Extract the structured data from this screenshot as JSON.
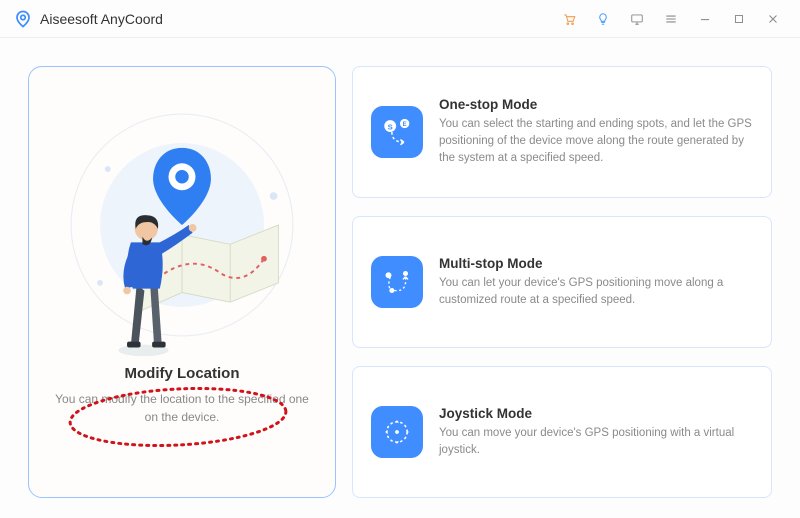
{
  "app": {
    "name": "Aiseesoft AnyCoord"
  },
  "left": {
    "title": "Modify Location",
    "desc": "You can modify the location to the specified one on the device."
  },
  "modes": [
    {
      "title": "One-stop Mode",
      "desc": "You can select the starting and ending spots, and let the GPS positioning of the device move along the route generated by the system at a specified speed."
    },
    {
      "title": "Multi-stop Mode",
      "desc": "You can let your device's GPS positioning move along a customized route at a specified speed."
    },
    {
      "title": "Joystick Mode",
      "desc": "You can move your device's GPS positioning with a virtual joystick."
    }
  ]
}
